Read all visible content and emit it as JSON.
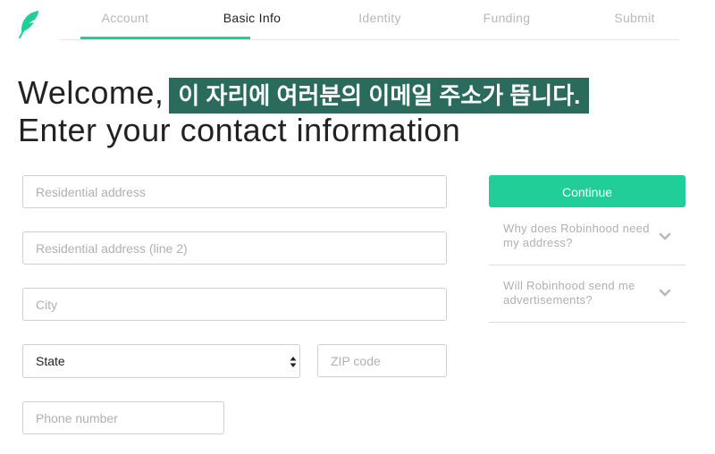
{
  "brand": {
    "logo_icon": "feather-icon",
    "color": "#21ce99"
  },
  "steps": [
    {
      "label": "Account",
      "active": false
    },
    {
      "label": "Basic Info",
      "active": true
    },
    {
      "label": "Identity",
      "active": false
    },
    {
      "label": "Funding",
      "active": false
    },
    {
      "label": "Submit",
      "active": false
    }
  ],
  "heading": {
    "welcome": "Welcome,",
    "email_banner": "이 자리에 여러분의 이메일 주소가 뜹니다.",
    "subtitle": "Enter your contact information"
  },
  "form": {
    "address_placeholder": "Residential address",
    "address2_placeholder": "Residential address (line 2)",
    "city_placeholder": "City",
    "state_value": "State",
    "zip_placeholder": "ZIP code",
    "phone_placeholder": "Phone number"
  },
  "sidebar": {
    "continue_label": "Continue",
    "faq": [
      {
        "line1": "Why does Robinhood need",
        "line2": "my address?"
      },
      {
        "line1": "Will Robinhood send me",
        "line2": "advertisements?"
      }
    ]
  },
  "colors": {
    "accent": "#21ce99",
    "banner": "#2a6b5e"
  }
}
